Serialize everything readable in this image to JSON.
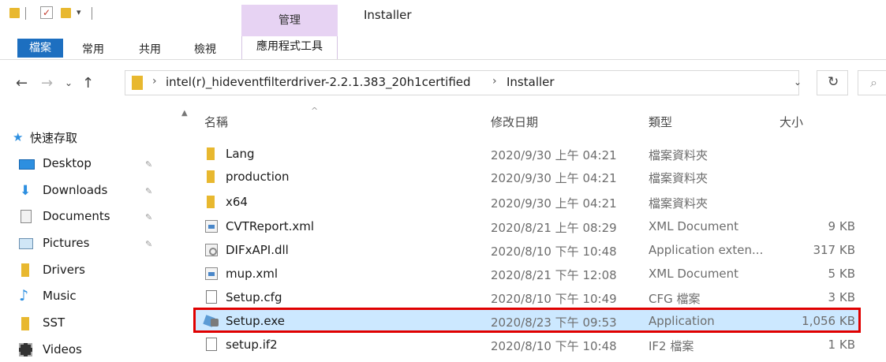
{
  "window": {
    "title": "Installer",
    "context_tab_group": "管理"
  },
  "ribbon": {
    "tabs": [
      "檔案",
      "常用",
      "共用",
      "檢視",
      "應用程式工具"
    ]
  },
  "address_bar": {
    "path": [
      "intel(r)_hideventfilterdriver-2.2.1.383_20h1certified",
      "Installer"
    ]
  },
  "nav_pane": {
    "quick_access": "快速存取",
    "items": [
      {
        "label": "Desktop",
        "icon": "desktop-icon",
        "pinned": true
      },
      {
        "label": "Downloads",
        "icon": "download-icon",
        "pinned": true
      },
      {
        "label": "Documents",
        "icon": "documents-icon",
        "pinned": true
      },
      {
        "label": "Pictures",
        "icon": "pictures-icon",
        "pinned": true
      },
      {
        "label": "Drivers",
        "icon": "folder-icon",
        "pinned": false
      },
      {
        "label": "Music",
        "icon": "music-icon",
        "pinned": false
      },
      {
        "label": "SST",
        "icon": "folder-icon",
        "pinned": false
      },
      {
        "label": "Videos",
        "icon": "videos-icon",
        "pinned": false
      }
    ]
  },
  "file_list": {
    "columns": [
      "名稱",
      "修改日期",
      "類型",
      "大小"
    ],
    "rows": [
      {
        "name": "Lang",
        "date": "2020/9/30 上午 04:21",
        "type": "檔案資料夾",
        "size": "",
        "icon": "folder-icon"
      },
      {
        "name": "production",
        "date": "2020/9/30 上午 04:21",
        "type": "檔案資料夾",
        "size": "",
        "icon": "folder-icon"
      },
      {
        "name": "x64",
        "date": "2020/9/30 上午 04:21",
        "type": "檔案資料夾",
        "size": "",
        "icon": "folder-icon"
      },
      {
        "name": "CVTReport.xml",
        "date": "2020/8/21 上午 08:29",
        "type": "XML Document",
        "size": "9 KB",
        "icon": "xml-file-icon"
      },
      {
        "name": "DIFxAPI.dll",
        "date": "2020/8/10 下午 10:48",
        "type": "Application exten...",
        "size": "317 KB",
        "icon": "dll-file-icon"
      },
      {
        "name": "mup.xml",
        "date": "2020/8/21 下午 12:08",
        "type": "XML Document",
        "size": "5 KB",
        "icon": "xml-file-icon"
      },
      {
        "name": "Setup.cfg",
        "date": "2020/8/10 下午 10:49",
        "type": "CFG 檔案",
        "size": "3 KB",
        "icon": "file-icon"
      },
      {
        "name": "Setup.exe",
        "date": "2020/8/23 下午 09:53",
        "type": "Application",
        "size": "1,056 KB",
        "icon": "exe-file-icon",
        "selected": true
      },
      {
        "name": "setup.if2",
        "date": "2020/8/10 下午 10:48",
        "type": "IF2 檔案",
        "size": "1 KB",
        "icon": "file-icon"
      }
    ]
  },
  "colors": {
    "file_tab": "#1d6fc0",
    "context_tab": "#e7d3f3",
    "selection": "#cce8ff",
    "highlight_box": "#e00000",
    "folder": "#e8b82f"
  }
}
